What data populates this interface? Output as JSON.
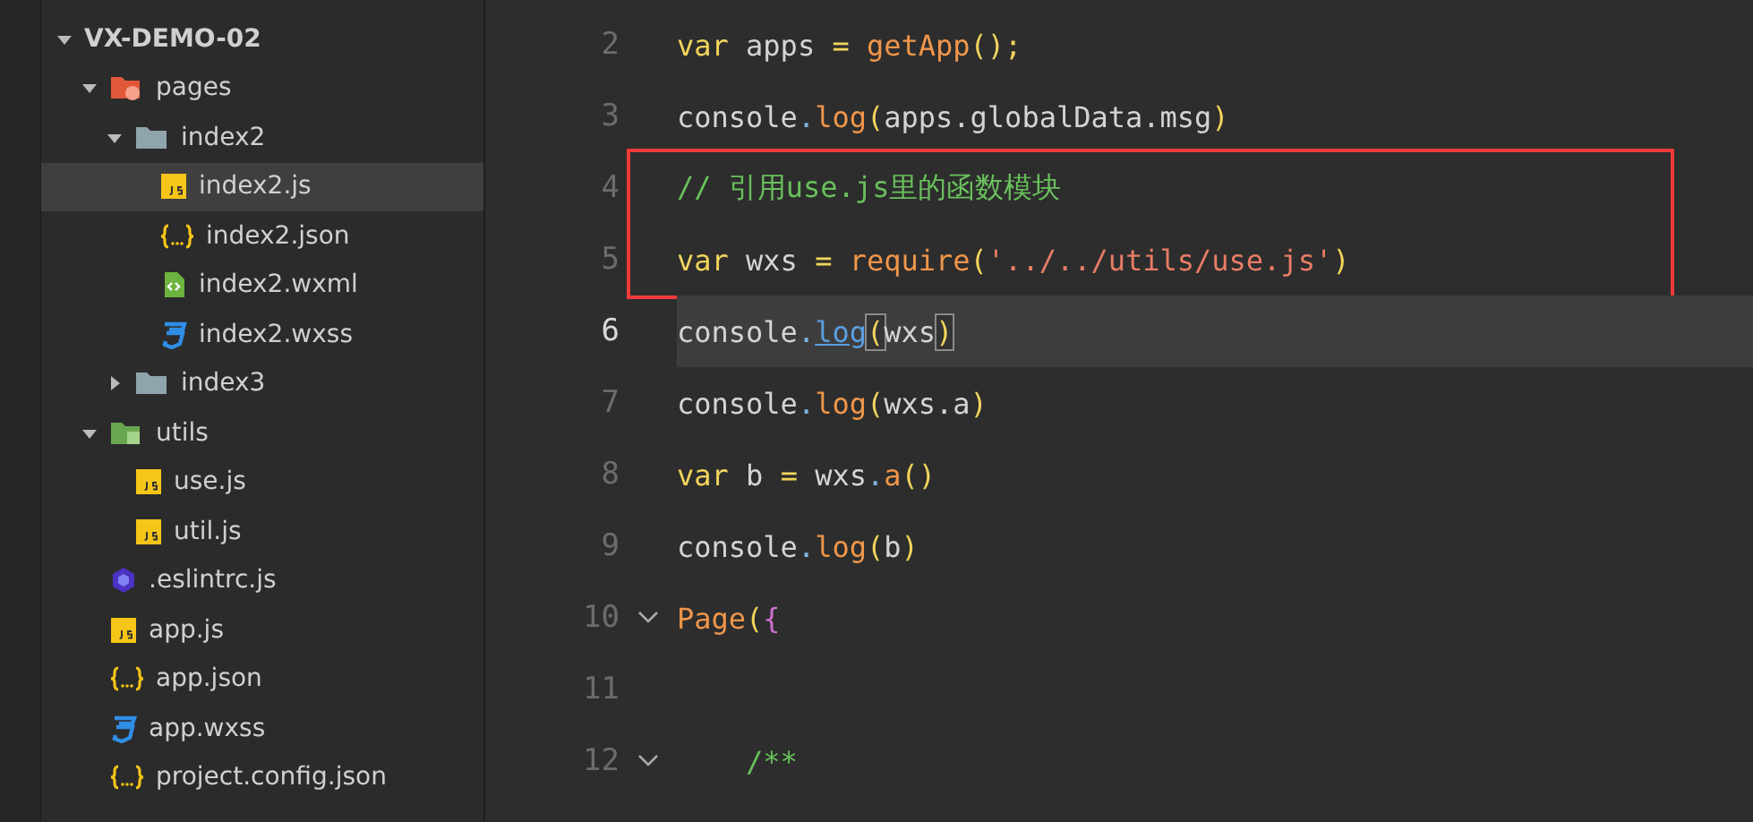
{
  "sidebar": {
    "tree": [
      {
        "label": "VX-DEMO-02",
        "kind": "root",
        "expanded": true,
        "selected": false,
        "children": [
          {
            "label": "pages",
            "kind": "folder-pages",
            "expanded": true,
            "selected": false,
            "children": [
              {
                "label": "index2",
                "kind": "folder",
                "expanded": true,
                "selected": false,
                "children": [
                  {
                    "label": "index2.js",
                    "kind": "js",
                    "selected": true
                  },
                  {
                    "label": "index2.json",
                    "kind": "json",
                    "selected": false
                  },
                  {
                    "label": "index2.wxml",
                    "kind": "wxml",
                    "selected": false
                  },
                  {
                    "label": "index2.wxss",
                    "kind": "wxss",
                    "selected": false
                  }
                ]
              },
              {
                "label": "index3",
                "kind": "folder",
                "expanded": false,
                "selected": false
              }
            ]
          },
          {
            "label": "utils",
            "kind": "folder-utils",
            "expanded": true,
            "selected": false,
            "children": [
              {
                "label": "use.js",
                "kind": "js",
                "selected": false
              },
              {
                "label": "util.js",
                "kind": "js",
                "selected": false
              }
            ]
          },
          {
            "label": ".eslintrc.js",
            "kind": "eslint",
            "selected": false
          },
          {
            "label": "app.js",
            "kind": "js",
            "selected": false
          },
          {
            "label": "app.json",
            "kind": "json",
            "selected": false
          },
          {
            "label": "app.wxss",
            "kind": "wxss",
            "selected": false
          },
          {
            "label": "project.config.json",
            "kind": "json",
            "selected": false
          }
        ]
      }
    ]
  },
  "editor": {
    "lines": [
      {
        "number": "2",
        "current": false,
        "fold": false,
        "boxed": false,
        "tokens": [
          {
            "text": "var",
            "kind": "keyword"
          },
          {
            "text": " apps",
            "kind": "plain"
          },
          {
            "text": " = ",
            "kind": "keyword"
          },
          {
            "text": "getApp",
            "kind": "func"
          },
          {
            "text": "();",
            "kind": "paren"
          }
        ]
      },
      {
        "number": "3",
        "current": false,
        "fold": false,
        "boxed": false,
        "tokens": [
          {
            "text": "console",
            "kind": "plain"
          },
          {
            "text": ".",
            "kind": "dot"
          },
          {
            "text": "log",
            "kind": "func"
          },
          {
            "text": "(",
            "kind": "paren"
          },
          {
            "text": "apps.globalData.msg",
            "kind": "plain"
          },
          {
            "text": ")",
            "kind": "paren"
          }
        ]
      },
      {
        "number": "4",
        "current": false,
        "fold": false,
        "boxed": true,
        "tokens": [
          {
            "text": "// 引用use.js里的函数模块",
            "kind": "comment"
          }
        ]
      },
      {
        "number": "5",
        "current": false,
        "fold": false,
        "boxed": true,
        "tokens": [
          {
            "text": "var",
            "kind": "keyword"
          },
          {
            "text": " wxs",
            "kind": "plain"
          },
          {
            "text": " = ",
            "kind": "keyword"
          },
          {
            "text": "require",
            "kind": "func"
          },
          {
            "text": "(",
            "kind": "paren"
          },
          {
            "text": "'../../utils/use.js'",
            "kind": "string"
          },
          {
            "text": ")",
            "kind": "paren"
          }
        ]
      },
      {
        "number": "6",
        "current": true,
        "fold": false,
        "boxed": false,
        "tokens": [
          {
            "text": "console",
            "kind": "plain"
          },
          {
            "text": ".",
            "kind": "dot"
          },
          {
            "text": "log",
            "kind": "link"
          },
          {
            "text": "(",
            "kind": "match"
          },
          {
            "text": "wxs",
            "kind": "plain"
          },
          {
            "text": ")",
            "kind": "match"
          }
        ]
      },
      {
        "number": "7",
        "current": false,
        "fold": false,
        "boxed": false,
        "tokens": [
          {
            "text": "console",
            "kind": "plain"
          },
          {
            "text": ".",
            "kind": "dot"
          },
          {
            "text": "log",
            "kind": "func"
          },
          {
            "text": "(",
            "kind": "paren"
          },
          {
            "text": "wxs.a",
            "kind": "plain"
          },
          {
            "text": ")",
            "kind": "paren"
          }
        ]
      },
      {
        "number": "8",
        "current": false,
        "fold": false,
        "boxed": false,
        "tokens": [
          {
            "text": "var",
            "kind": "keyword"
          },
          {
            "text": " b ",
            "kind": "plain"
          },
          {
            "text": "=",
            "kind": "keyword"
          },
          {
            "text": " wxs",
            "kind": "plain"
          },
          {
            "text": ".",
            "kind": "dot"
          },
          {
            "text": "a",
            "kind": "func"
          },
          {
            "text": "()",
            "kind": "paren"
          }
        ]
      },
      {
        "number": "9",
        "current": false,
        "fold": false,
        "boxed": false,
        "tokens": [
          {
            "text": "console",
            "kind": "plain"
          },
          {
            "text": ".",
            "kind": "dot"
          },
          {
            "text": "log",
            "kind": "func"
          },
          {
            "text": "(",
            "kind": "paren"
          },
          {
            "text": "b",
            "kind": "plain"
          },
          {
            "text": ")",
            "kind": "paren"
          }
        ]
      },
      {
        "number": "10",
        "current": false,
        "fold": true,
        "boxed": false,
        "tokens": [
          {
            "text": "Page",
            "kind": "func"
          },
          {
            "text": "(",
            "kind": "paren"
          },
          {
            "text": "{",
            "kind": "brace"
          }
        ]
      },
      {
        "number": "11",
        "current": false,
        "fold": false,
        "boxed": false
      },
      {
        "number": "12",
        "current": false,
        "fold": true,
        "boxed": false,
        "tokens": [
          {
            "text": "    /**",
            "kind": "comment"
          }
        ]
      }
    ]
  }
}
